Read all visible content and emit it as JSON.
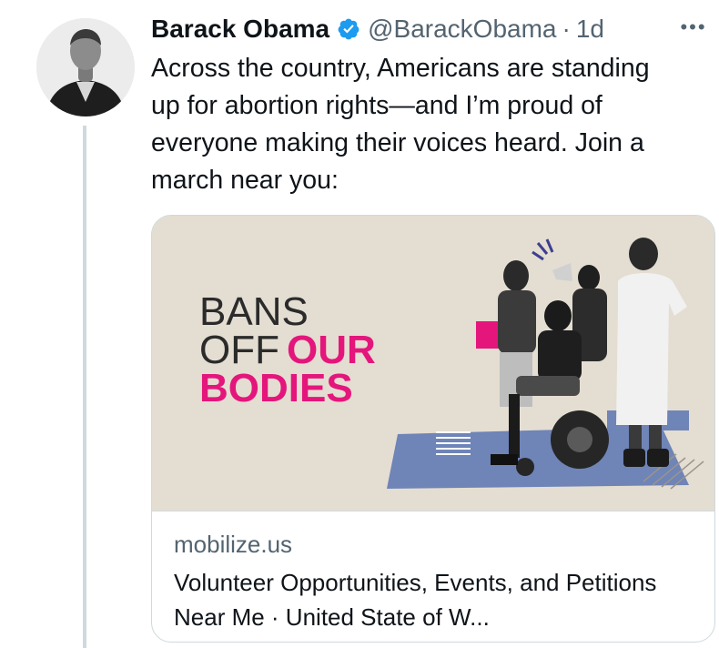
{
  "tweet": {
    "author_name": "Barack Obama",
    "handle": "@BarackObama",
    "separator": "·",
    "time": "1d",
    "more_label": "•••",
    "text": "Across the country, Americans are standing up for abortion rights—and I’m proud of everyone making their voices heard. Join a march near you:"
  },
  "card": {
    "headline_line1": "BANS",
    "headline_line2_a": "OFF",
    "headline_line2_b": "OUR",
    "headline_line3": "BODIES",
    "domain": "mobilize.us",
    "title": "Volunteer Opportunities, Events, and Petitions Near Me · United State of W..."
  },
  "colors": {
    "verified_blue": "#1d9bf0",
    "card_bg": "#e4ddd1",
    "accent_pink": "#e4167c",
    "accent_blue": "#6f84b7",
    "headline_dark": "#2b2b2b"
  },
  "icons": {
    "verified": "verified-badge-icon",
    "more": "more-options-icon"
  }
}
